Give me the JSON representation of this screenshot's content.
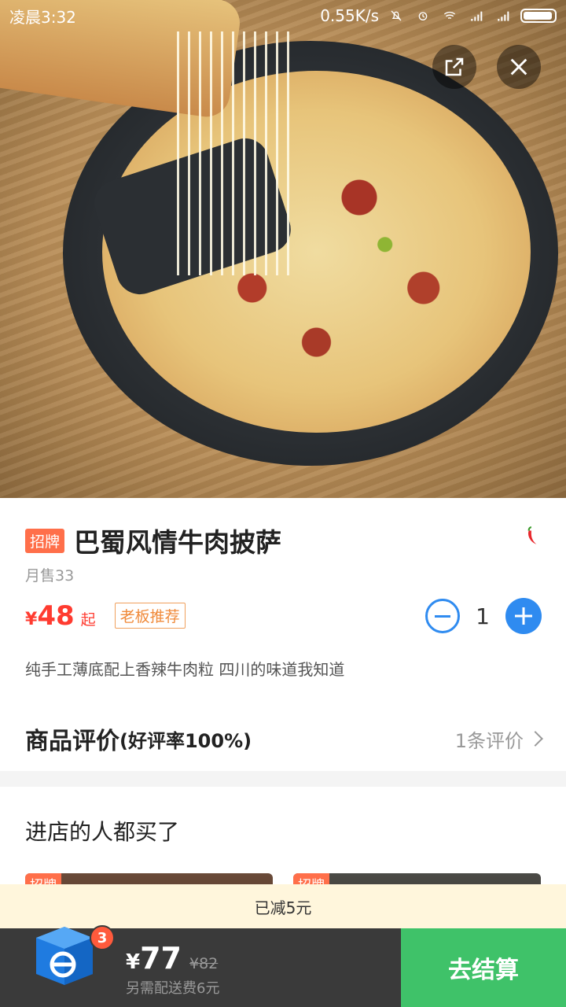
{
  "status_bar": {
    "time": "凌晨3:32",
    "network_speed": "0.55K/s",
    "icons": [
      "mute-icon",
      "alarm-icon",
      "wifi-icon",
      "signal-icon",
      "signal-icon",
      "battery-icon"
    ]
  },
  "hero": {
    "image": "pizza-photo",
    "share_icon": "share-icon",
    "close_icon": "close-icon"
  },
  "product": {
    "badge": "招牌",
    "name": "巴蜀风情牛肉披萨",
    "spicy_icon": "chili-icon",
    "sales": "月售33",
    "currency": "¥",
    "price": "48",
    "price_suffix": "起",
    "boss_tag": "老板推荐",
    "quantity": "1",
    "description": "纯手工薄底配上香辣牛肉粒 四川的味道我知道"
  },
  "review": {
    "title": "商品评价",
    "rate": "(好评率100%)",
    "count": "1条评价"
  },
  "recommend": {
    "title": "进店的人都买了",
    "items": [
      {
        "badge": "招牌"
      },
      {
        "badge": "招牌"
      }
    ]
  },
  "discount": {
    "text": "已减5元"
  },
  "cart": {
    "badge_count": "3",
    "currency": "¥",
    "total": "77",
    "original": "¥82",
    "delivery_note": "另需配送费6元",
    "checkout_label": "去结算",
    "colors": {
      "checkout": "#3fc269",
      "bar": "#3a3a3a",
      "badge": "#ff5a3c"
    }
  },
  "accent_colors": {
    "price": "#ff3b30",
    "stepper": "#2f8bf0",
    "badge": "#ff6f4a"
  }
}
